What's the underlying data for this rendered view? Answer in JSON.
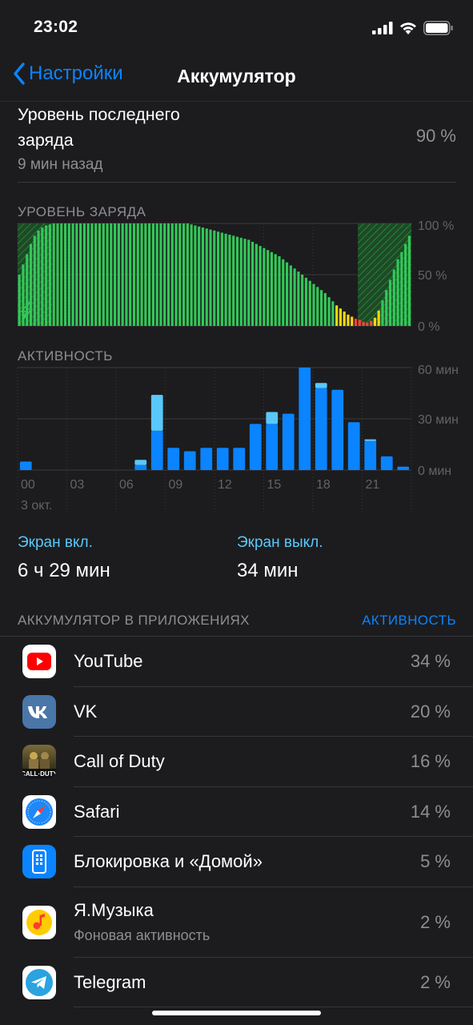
{
  "status": {
    "time": "23:02"
  },
  "nav": {
    "back_label": "Настройки",
    "title": "Аккумулятор"
  },
  "last_charge": {
    "title": "Уровень последнего заряда",
    "subtitle": "9 мин назад",
    "value": "90 %"
  },
  "charge_section": {
    "label": "УРОВЕНЬ ЗАРЯДА",
    "y_ticks": [
      "100 %",
      "50 %",
      "0 %"
    ]
  },
  "activity_section": {
    "label": "АКТИВНОСТЬ",
    "y_ticks": [
      "60 мин",
      "30 мин",
      "0 мин"
    ],
    "x_ticks": [
      "00",
      "03",
      "06",
      "09",
      "12",
      "15",
      "18",
      "21"
    ],
    "date_label": "3 окт."
  },
  "chart_data": [
    {
      "type": "bar",
      "title": "УРОВЕНЬ ЗАРЯДА",
      "ylabel": "",
      "ylim": [
        0,
        100
      ],
      "y_ticks": [
        "100 %",
        "50 %",
        "0 %"
      ],
      "series": [
        {
          "values": [
            50,
            60,
            70,
            80,
            88,
            93,
            96,
            98,
            99,
            100,
            100,
            100,
            100,
            100,
            100,
            100,
            100,
            100,
            100,
            100,
            100,
            100,
            100,
            100,
            100,
            100,
            100,
            100,
            100,
            100,
            100,
            100,
            100,
            100,
            100,
            100,
            100,
            100,
            100,
            100,
            100,
            100,
            100,
            100,
            100,
            99,
            98,
            97,
            96,
            95,
            94,
            93,
            92,
            91,
            90,
            89,
            88,
            87,
            86,
            85,
            84,
            82,
            80,
            78,
            76,
            74,
            72,
            70,
            68,
            65,
            62,
            59,
            56,
            53,
            50,
            47,
            44,
            41,
            38,
            35,
            32,
            28,
            24,
            20,
            17,
            14,
            11,
            9,
            7,
            6,
            4,
            3,
            5,
            8,
            15,
            25,
            35,
            45,
            55,
            65,
            72,
            80,
            88
          ],
          "colors_note": "green for normal, yellow for low (<=20), red for critical (<=5)"
        }
      ],
      "charging_periods": [
        "00:00-00:45",
        "20:40-23:02"
      ]
    },
    {
      "type": "bar",
      "title": "АКТИВНОСТЬ",
      "ylabel": "",
      "ylim": [
        0,
        60
      ],
      "categories": [
        "00",
        "01",
        "02",
        "03",
        "04",
        "05",
        "06",
        "07",
        "08",
        "09",
        "10",
        "11",
        "12",
        "13",
        "14",
        "15",
        "16",
        "17",
        "18",
        "19",
        "20",
        "21",
        "22",
        "23"
      ],
      "series": [
        {
          "name": "Экран вкл.",
          "values": [
            5,
            0,
            0,
            0,
            0,
            0,
            0,
            3,
            23,
            13,
            11,
            13,
            13,
            13,
            27,
            27,
            33,
            60,
            48,
            47,
            28,
            17,
            8,
            2
          ]
        },
        {
          "name": "Экран выкл.",
          "values": [
            0,
            0,
            0,
            0,
            0,
            0,
            0,
            3,
            21,
            0,
            0,
            0,
            0,
            0,
            0,
            7,
            0,
            0,
            3,
            0,
            0,
            1,
            0,
            0
          ]
        }
      ]
    }
  ],
  "screen_stats": {
    "on_label": "Экран вкл.",
    "on_value": "6 ч 29 мин",
    "off_label": "Экран выкл.",
    "off_value": "34 мин"
  },
  "apps": {
    "header": "АККУМУЛЯТОР В ПРИЛОЖЕНИЯХ",
    "toggle_label": "АКТИВНОСТЬ",
    "items": [
      {
        "name": "YouTube",
        "pct": "34 %",
        "icon": "youtube-icon"
      },
      {
        "name": "VK",
        "pct": "20 %",
        "icon": "vk-icon"
      },
      {
        "name": "Call of Duty",
        "pct": "16 %",
        "icon": "call-of-duty-icon",
        "icon_text": "CALL·DUTY"
      },
      {
        "name": "Safari",
        "pct": "14 %",
        "icon": "safari-icon"
      },
      {
        "name": "Блокировка и «Домой»",
        "pct": "5 %",
        "icon": "phone-icon"
      },
      {
        "name": "Я.Музыка",
        "sub": "Фоновая активность",
        "pct": "2 %",
        "icon": "music-icon"
      },
      {
        "name": "Telegram",
        "pct": "2 %",
        "icon": "telegram-icon"
      }
    ]
  },
  "colors": {
    "accent": "#0a84ff",
    "green": "#34c759",
    "yellow": "#ffd60a",
    "red": "#ff453a",
    "screen_on": "#0a84ff",
    "screen_off": "#5ac8fa"
  }
}
